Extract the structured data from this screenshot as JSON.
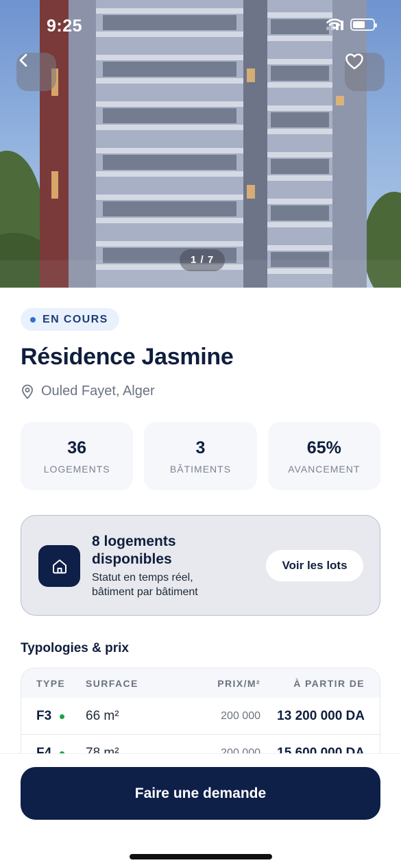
{
  "status_bar": {
    "time": "9:25"
  },
  "hero": {
    "image_counter": "1 / 7"
  },
  "project": {
    "status": "EN COURS",
    "name": "Résidence Jasmine",
    "location": "Ouled Fayet, Alger"
  },
  "stats": [
    {
      "value": "36",
      "label": "LOGEMENTS"
    },
    {
      "value": "3",
      "label": "BÂTIMENTS"
    },
    {
      "value": "65%",
      "label": "AVANCEMENT"
    }
  ],
  "availability": {
    "title": "8 logements disponibles",
    "subtitle": "Statut en temps réel, bâtiment par bâtiment",
    "button": "Voir les lots"
  },
  "typologies": {
    "title": "Typologies & prix",
    "headers": {
      "type": "TYPE",
      "surface": "SURFACE",
      "price_m2": "PRIX/M²",
      "from": "À PARTIR DE"
    },
    "rows": [
      {
        "type": "F3",
        "surface": "66 m²",
        "price_m2": "200 000",
        "price": "13 200 000 DA"
      },
      {
        "type": "F4",
        "surface": "78 m²",
        "price_m2": "200 000",
        "price": "15 600 000 DA"
      }
    ]
  },
  "cta": {
    "label": "Faire une demande"
  },
  "colors": {
    "navy": "#0e1f48",
    "accent_blue": "#2f6fd6",
    "available_green": "#16a34a"
  },
  "icons": {
    "back": "chevron-left-icon",
    "favorite": "heart-icon",
    "location": "map-pin-icon",
    "availability": "home-icon"
  }
}
